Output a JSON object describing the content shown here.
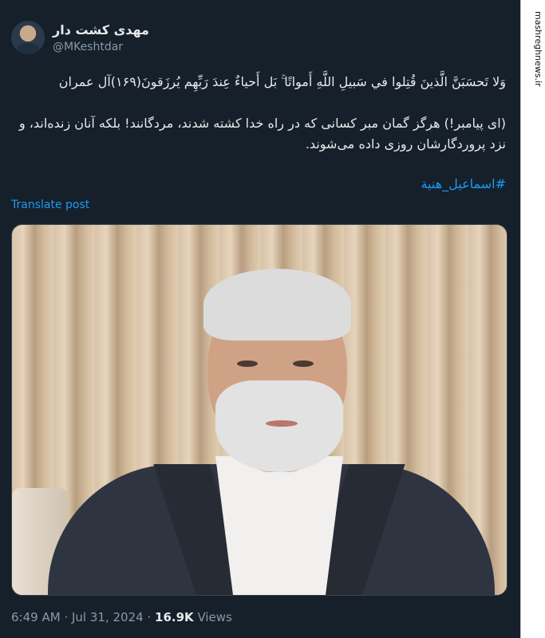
{
  "author": {
    "display_name": "مهدی کشت دار",
    "handle": "@MKeshtdar"
  },
  "tweet": {
    "arabic_verse": "وَلا تَحسَبَنَّ الَّذينَ قُتِلوا في سَبيلِ اللَّهِ أَمواتًا ۚ بَل أَحياءٌ عِندَ رَبِّهِم يُرزَقونَ(١۶٩)آل عمران",
    "persian_translation": "(ای پیامبر!) هرگز گمان مبر کسانی که در راه خدا کشته شدند، مردگانند! بلکه آنان زنده‌اند، و نزد پروردگارشان روزی داده می‌شوند.",
    "hashtag": "#اسماعیل_هنیة",
    "translate_label": "Translate post"
  },
  "meta": {
    "time": "6:49 AM",
    "separator": "·",
    "date": "Jul 31, 2024",
    "views_count": "16.9K",
    "views_label": "Views"
  },
  "watermark": {
    "text": "mashreghnews.ir"
  },
  "icons": {
    "watermark_logo": "mashregh-logo-icon"
  },
  "colors": {
    "background": "#15202b",
    "link": "#1d9bf0",
    "muted": "#8b98a5"
  }
}
